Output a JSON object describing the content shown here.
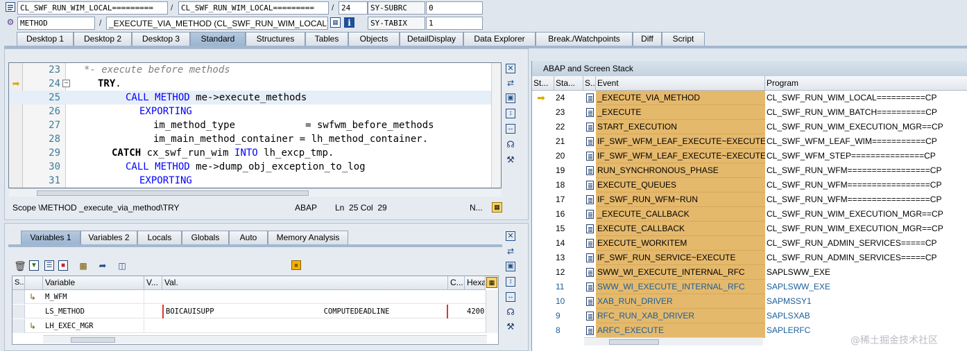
{
  "header": {
    "row1": {
      "class_field": "CL_SWF_RUN_WIM_LOCAL=========",
      "sep1": "/",
      "include_field": "CL_SWF_RUN_WIM_LOCAL=========",
      "sep2": "/",
      "line_field": "24",
      "sysvar_name": "SY-SUBRC",
      "sysvar_value": "0"
    },
    "row2": {
      "type_field": "METHOD",
      "sep1": "/",
      "method_field": "_EXECUTE_VIA_METHOD (CL_SWF_RUN_WIM_LOCAL)",
      "sysvar_name": "SY-TABIX",
      "sysvar_value": "1"
    }
  },
  "tabs": [
    "Desktop 1",
    "Desktop 2",
    "Desktop 3",
    "Standard",
    "Structures",
    "Tables",
    "Objects",
    "DetailDisplay",
    "Data Explorer",
    "Break./Watchpoints",
    "Diff",
    "Script"
  ],
  "active_tab": "Standard",
  "editor": {
    "lines": [
      {
        "num": "23",
        "parts": [
          [
            "cm",
            "*- execute before methods"
          ]
        ],
        "indent": 0
      },
      {
        "num": "24",
        "parts": [
          [
            "kwb",
            "TRY"
          ],
          [
            "",
            "."
          ]
        ],
        "indent": 1
      },
      {
        "num": "25",
        "parts": [
          [
            "kw",
            "CALL METHOD"
          ],
          [
            "",
            " me->execute_methods"
          ]
        ],
        "indent": 3
      },
      {
        "num": "26",
        "parts": [
          [
            "kw",
            "EXPORTING"
          ]
        ],
        "indent": 4
      },
      {
        "num": "27",
        "parts": [
          [
            "",
            "im_method_type            = swfwm_before_methods"
          ]
        ],
        "indent": 5
      },
      {
        "num": "28",
        "parts": [
          [
            "",
            "im_main_method_container = lh_method_container."
          ]
        ],
        "indent": 5
      },
      {
        "num": "29",
        "parts": [
          [
            "kwb",
            "CATCH"
          ],
          [
            "",
            " cx_swf_run_wim "
          ],
          [
            "kw",
            "INTO"
          ],
          [
            "",
            " lh_excp_tmp."
          ]
        ],
        "indent": 2
      },
      {
        "num": "30",
        "parts": [
          [
            "kw",
            "CALL METHOD"
          ],
          [
            "",
            " me->dump_obj_exception_to_log"
          ]
        ],
        "indent": 3
      },
      {
        "num": "31",
        "parts": [
          [
            "kw",
            "EXPORTING"
          ]
        ],
        "indent": 4
      }
    ],
    "current_line": "24",
    "status": {
      "scope": "Scope \\METHOD _execute_via_method\\TRY",
      "lang": "ABAP",
      "position": "Ln  25 Col  29",
      "mode": "N..."
    }
  },
  "var_tabs": [
    "Variables 1",
    "Variables 2",
    "Locals",
    "Globals",
    "Auto",
    "Memory Analysis"
  ],
  "var_active_tab": "Variables 1",
  "var_table": {
    "headers": [
      "S...",
      "Variable",
      "V...",
      "Val.",
      "C...",
      "Hexa"
    ],
    "rows": [
      {
        "icon": "object-ref-icon",
        "name": "M_WFM",
        "value": "",
        "hex": ""
      },
      {
        "icon": "",
        "name": "LS_METHOD",
        "value": "BOICAUISUPP                         COMPUTEDEADLINE",
        "hex": "4200"
      },
      {
        "icon": "object-ref-icon",
        "name": "LH_EXEC_MGR",
        "value": "",
        "hex": ""
      }
    ]
  },
  "stack": {
    "title": "ABAP and Screen Stack",
    "headers": [
      "St...",
      "Sta...",
      "S...",
      "Event",
      "Program"
    ],
    "rows": [
      {
        "level": "24",
        "event": "_EXECUTE_VIA_METHOD",
        "program": "CL_SWF_RUN_WIM_LOCAL==========CP",
        "current": true,
        "blue": false
      },
      {
        "level": "23",
        "event": "_EXECUTE",
        "program": "CL_SWF_RUN_WIM_BATCH==========CP",
        "current": false,
        "blue": false
      },
      {
        "level": "22",
        "event": "START_EXECUTION",
        "program": "CL_SWF_RUN_WIM_EXECUTION_MGR==CP",
        "current": false,
        "blue": false
      },
      {
        "level": "21",
        "event": "IF_SWF_WFM_LEAF_EXECUTE~EXECUTE",
        "program": "CL_SWF_WFM_LEAF_WIM===========CP",
        "current": false,
        "blue": false
      },
      {
        "level": "20",
        "event": "IF_SWF_WFM_LEAF_EXECUTE~EXECUTE",
        "program": "CL_SWF_WFM_STEP===============CP",
        "current": false,
        "blue": false
      },
      {
        "level": "19",
        "event": "RUN_SYNCHRONOUS_PHASE",
        "program": "CL_SWF_RUN_WFM=================CP",
        "current": false,
        "blue": false
      },
      {
        "level": "18",
        "event": "EXECUTE_QUEUES",
        "program": "CL_SWF_RUN_WFM=================CP",
        "current": false,
        "blue": false
      },
      {
        "level": "17",
        "event": "IF_SWF_RUN_WFM~RUN",
        "program": "CL_SWF_RUN_WFM=================CP",
        "current": false,
        "blue": false
      },
      {
        "level": "16",
        "event": "_EXECUTE_CALLBACK",
        "program": "CL_SWF_RUN_WIM_EXECUTION_MGR==CP",
        "current": false,
        "blue": false
      },
      {
        "level": "15",
        "event": "EXECUTE_CALLBACK",
        "program": "CL_SWF_RUN_WIM_EXECUTION_MGR==CP",
        "current": false,
        "blue": false
      },
      {
        "level": "14",
        "event": "EXECUTE_WORKITEM",
        "program": "CL_SWF_RUN_ADMIN_SERVICES=====CP",
        "current": false,
        "blue": false
      },
      {
        "level": "13",
        "event": "IF_SWF_RUN_SERVICE~EXECUTE",
        "program": "CL_SWF_RUN_ADMIN_SERVICES=====CP",
        "current": false,
        "blue": false
      },
      {
        "level": "12",
        "event": "SWW_WI_EXECUTE_INTERNAL_RFC",
        "program": "SAPLSWW_EXE",
        "current": false,
        "blue": false
      },
      {
        "level": "11",
        "event": "SWW_WI_EXECUTE_INTERNAL_RFC",
        "program": "SAPLSWW_EXE",
        "current": false,
        "blue": true
      },
      {
        "level": "10",
        "event": "XAB_RUN_DRIVER",
        "program": "SAPMSSY1",
        "current": false,
        "blue": true
      },
      {
        "level": "9",
        "event": "RFC_RUN_XAB_DRIVER",
        "program": "SAPLSXAB",
        "current": false,
        "blue": true
      },
      {
        "level": "8",
        "event": "ARFC_EXECUTE",
        "program": "SAPLERFC",
        "current": false,
        "blue": true
      }
    ]
  },
  "watermark": "@稀土掘金技术社区",
  "colors": {
    "event_bg": "#e5b96c",
    "keyword": "#0000ff",
    "comment": "#808080",
    "active_tab": "#9bb5d2"
  }
}
